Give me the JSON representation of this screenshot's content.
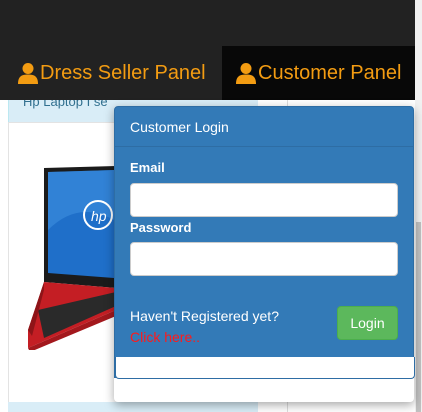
{
  "nav": {
    "dress_seller": {
      "label": "Dress Seller Panel",
      "icon": "user-icon"
    },
    "customer": {
      "label": "Customer Panel",
      "icon": "user-icon"
    },
    "accent_color": "#f39c12"
  },
  "product": {
    "panel_title": "Hp Laptop I se",
    "image": "hp-laptop-red"
  },
  "login": {
    "heading": "Customer Login",
    "email_label": "Email",
    "email_value": "",
    "password_label": "Password",
    "password_value": "",
    "register_text": "Haven't Registered yet?",
    "register_link": "Click here..",
    "login_button": "Login",
    "panel_color": "#337ab7",
    "button_color": "#5cb85c"
  }
}
